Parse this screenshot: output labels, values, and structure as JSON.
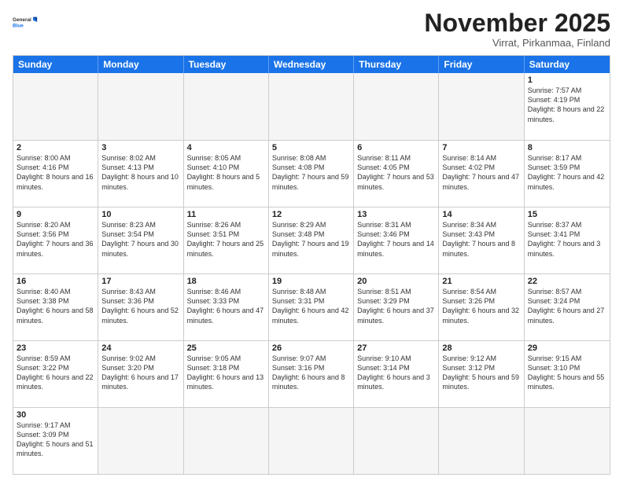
{
  "logo": {
    "text_general": "General",
    "text_blue": "Blue"
  },
  "title": "November 2025",
  "subtitle": "Virrat, Pirkanmaa, Finland",
  "header_days": [
    "Sunday",
    "Monday",
    "Tuesday",
    "Wednesday",
    "Thursday",
    "Friday",
    "Saturday"
  ],
  "weeks": [
    [
      {
        "day": "",
        "info": ""
      },
      {
        "day": "",
        "info": ""
      },
      {
        "day": "",
        "info": ""
      },
      {
        "day": "",
        "info": ""
      },
      {
        "day": "",
        "info": ""
      },
      {
        "day": "",
        "info": ""
      },
      {
        "day": "1",
        "info": "Sunrise: 7:57 AM\nSunset: 4:19 PM\nDaylight: 8 hours and 22 minutes."
      }
    ],
    [
      {
        "day": "2",
        "info": "Sunrise: 8:00 AM\nSunset: 4:16 PM\nDaylight: 8 hours and 16 minutes."
      },
      {
        "day": "3",
        "info": "Sunrise: 8:02 AM\nSunset: 4:13 PM\nDaylight: 8 hours and 10 minutes."
      },
      {
        "day": "4",
        "info": "Sunrise: 8:05 AM\nSunset: 4:10 PM\nDaylight: 8 hours and 5 minutes."
      },
      {
        "day": "5",
        "info": "Sunrise: 8:08 AM\nSunset: 4:08 PM\nDaylight: 7 hours and 59 minutes."
      },
      {
        "day": "6",
        "info": "Sunrise: 8:11 AM\nSunset: 4:05 PM\nDaylight: 7 hours and 53 minutes."
      },
      {
        "day": "7",
        "info": "Sunrise: 8:14 AM\nSunset: 4:02 PM\nDaylight: 7 hours and 47 minutes."
      },
      {
        "day": "8",
        "info": "Sunrise: 8:17 AM\nSunset: 3:59 PM\nDaylight: 7 hours and 42 minutes."
      }
    ],
    [
      {
        "day": "9",
        "info": "Sunrise: 8:20 AM\nSunset: 3:56 PM\nDaylight: 7 hours and 36 minutes."
      },
      {
        "day": "10",
        "info": "Sunrise: 8:23 AM\nSunset: 3:54 PM\nDaylight: 7 hours and 30 minutes."
      },
      {
        "day": "11",
        "info": "Sunrise: 8:26 AM\nSunset: 3:51 PM\nDaylight: 7 hours and 25 minutes."
      },
      {
        "day": "12",
        "info": "Sunrise: 8:29 AM\nSunset: 3:48 PM\nDaylight: 7 hours and 19 minutes."
      },
      {
        "day": "13",
        "info": "Sunrise: 8:31 AM\nSunset: 3:46 PM\nDaylight: 7 hours and 14 minutes."
      },
      {
        "day": "14",
        "info": "Sunrise: 8:34 AM\nSunset: 3:43 PM\nDaylight: 7 hours and 8 minutes."
      },
      {
        "day": "15",
        "info": "Sunrise: 8:37 AM\nSunset: 3:41 PM\nDaylight: 7 hours and 3 minutes."
      }
    ],
    [
      {
        "day": "16",
        "info": "Sunrise: 8:40 AM\nSunset: 3:38 PM\nDaylight: 6 hours and 58 minutes."
      },
      {
        "day": "17",
        "info": "Sunrise: 8:43 AM\nSunset: 3:36 PM\nDaylight: 6 hours and 52 minutes."
      },
      {
        "day": "18",
        "info": "Sunrise: 8:46 AM\nSunset: 3:33 PM\nDaylight: 6 hours and 47 minutes."
      },
      {
        "day": "19",
        "info": "Sunrise: 8:48 AM\nSunset: 3:31 PM\nDaylight: 6 hours and 42 minutes."
      },
      {
        "day": "20",
        "info": "Sunrise: 8:51 AM\nSunset: 3:29 PM\nDaylight: 6 hours and 37 minutes."
      },
      {
        "day": "21",
        "info": "Sunrise: 8:54 AM\nSunset: 3:26 PM\nDaylight: 6 hours and 32 minutes."
      },
      {
        "day": "22",
        "info": "Sunrise: 8:57 AM\nSunset: 3:24 PM\nDaylight: 6 hours and 27 minutes."
      }
    ],
    [
      {
        "day": "23",
        "info": "Sunrise: 8:59 AM\nSunset: 3:22 PM\nDaylight: 6 hours and 22 minutes."
      },
      {
        "day": "24",
        "info": "Sunrise: 9:02 AM\nSunset: 3:20 PM\nDaylight: 6 hours and 17 minutes."
      },
      {
        "day": "25",
        "info": "Sunrise: 9:05 AM\nSunset: 3:18 PM\nDaylight: 6 hours and 13 minutes."
      },
      {
        "day": "26",
        "info": "Sunrise: 9:07 AM\nSunset: 3:16 PM\nDaylight: 6 hours and 8 minutes."
      },
      {
        "day": "27",
        "info": "Sunrise: 9:10 AM\nSunset: 3:14 PM\nDaylight: 6 hours and 3 minutes."
      },
      {
        "day": "28",
        "info": "Sunrise: 9:12 AM\nSunset: 3:12 PM\nDaylight: 5 hours and 59 minutes."
      },
      {
        "day": "29",
        "info": "Sunrise: 9:15 AM\nSunset: 3:10 PM\nDaylight: 5 hours and 55 minutes."
      }
    ],
    [
      {
        "day": "30",
        "info": "Sunrise: 9:17 AM\nSunset: 3:09 PM\nDaylight: 5 hours and 51 minutes."
      },
      {
        "day": "",
        "info": ""
      },
      {
        "day": "",
        "info": ""
      },
      {
        "day": "",
        "info": ""
      },
      {
        "day": "",
        "info": ""
      },
      {
        "day": "",
        "info": ""
      },
      {
        "day": "",
        "info": ""
      }
    ]
  ]
}
